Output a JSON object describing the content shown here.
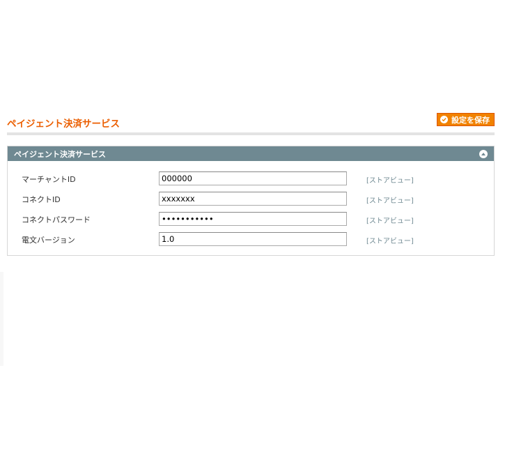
{
  "page": {
    "title": "ペイジェント決済サービス",
    "save_label": "設定を保存"
  },
  "fieldset": {
    "title": "ペイジェント決済サービス",
    "fields": [
      {
        "label": "マーチャントID",
        "value": "000000",
        "type": "text",
        "scope": "[ストアビュー]"
      },
      {
        "label": "コネクトID",
        "value": "xxxxxxx",
        "type": "text",
        "scope": "[ストアビュー]"
      },
      {
        "label": "コネクトパスワード",
        "value": "xxxxxxxxxxx",
        "type": "password",
        "scope": "[ストアビュー]"
      },
      {
        "label": "電文バージョン",
        "value": "1.0",
        "type": "text",
        "scope": "[ストアビュー]"
      }
    ]
  },
  "colors": {
    "title": "#eb5e00",
    "button": "#f18200",
    "header_bar": "#6f8992",
    "scope_text": "#6f8992"
  },
  "icons": {
    "save": "check-circle-icon",
    "collapse": "collapse-up-icon"
  }
}
